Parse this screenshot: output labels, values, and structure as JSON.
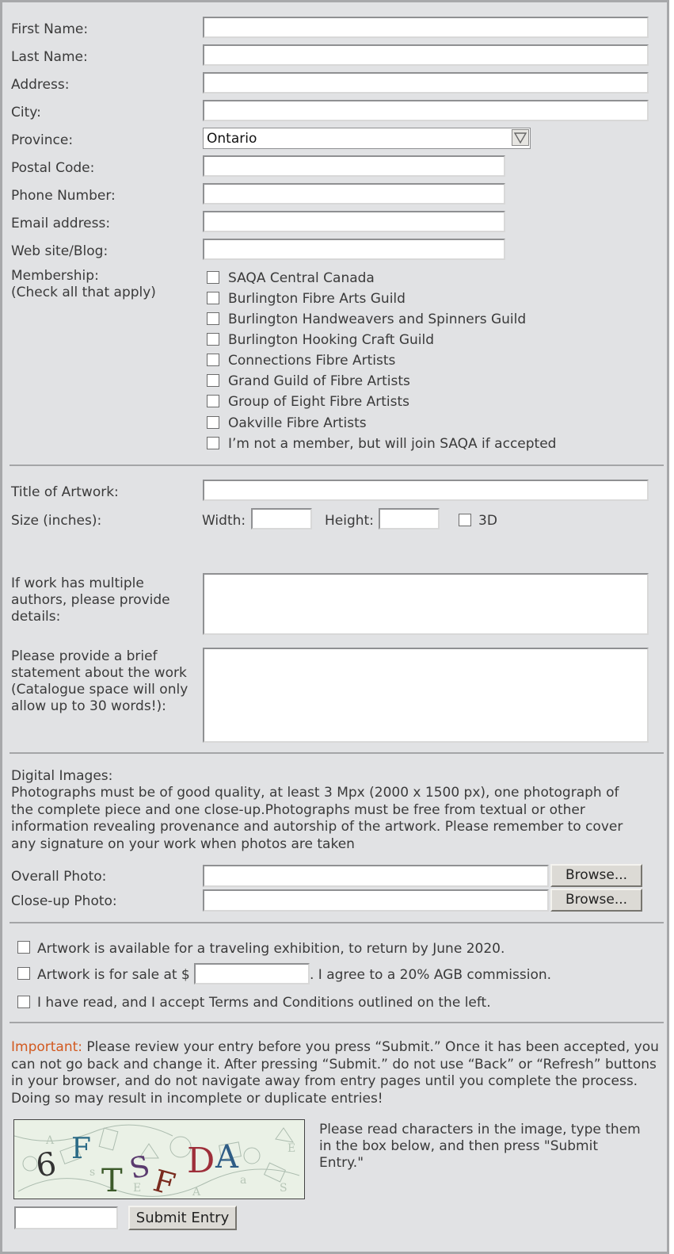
{
  "contact": {
    "first_name_label": "First Name:",
    "last_name_label": "Last Name:",
    "address_label": "Address:",
    "city_label": "City:",
    "province_label": "Province:",
    "province_value": "Ontario",
    "postal_code_label": "Postal Code:",
    "phone_label": "Phone Number:",
    "email_label": "Email address:",
    "website_label": "Web site/Blog:"
  },
  "membership": {
    "label_line1": "Membership:",
    "label_line2": "(Check all that apply)",
    "options": [
      "SAQA Central Canada",
      "Burlington Fibre Arts Guild",
      "Burlington Handweavers and Spinners Guild",
      "Burlington Hooking Craft Guild",
      "Connections Fibre Artists",
      "Grand Guild of Fibre Artists",
      "Group of Eight Fibre Artists",
      "Oakville Fibre Artists",
      "I’m not a member, but will join SAQA if accepted"
    ]
  },
  "artwork": {
    "title_label": "Title of Artwork:",
    "size_label": "Size (inches):",
    "width_label": "Width:",
    "height_label": "Height:",
    "three_d_label": "3D",
    "authors_label": [
      "If work has multiple",
      "authors, please provide",
      "details:"
    ],
    "statement_label": [
      "Please provide a brief",
      "statement about the work",
      "(Catalogue space will only",
      "allow up to 30 words!):"
    ]
  },
  "images": {
    "heading": "Digital Images:",
    "description": "Photographs must be of good quality, at least 3 Mpx (2000 x 1500 px), one photograph of the complete piece and one close-up.Photographs must be free from textual or other information revealing provenance and autorship of the artwork. Please remember to cover any signature on your work when photos are taken",
    "overall_label": "Overall Photo:",
    "closeup_label": "Close-up Photo:",
    "browse_label": "Browse..."
  },
  "terms": {
    "traveling": "Artwork is available for a traveling exhibition, to return by June 2020.",
    "sale_prefix": "Artwork is for sale at $",
    "sale_suffix": ". I agree to a 20% AGB commission.",
    "accept": "I have read, and I accept Terms and Conditions outlined on the left."
  },
  "notice": {
    "important_label": "Important:",
    "important_text": " Please review your entry before you press “Submit.” Once it has been accepted, you can not go back and change it. After pressing “Submit.” do not use “Back” or “Refresh” buttons in your browser, and do not navigate away from entry pages until you complete the process. Doing so may result in incomplete or duplicate entries!",
    "important_color": "#d2591f"
  },
  "captcha": {
    "characters": "6FTSFDA",
    "instructions": "Please read characters in the image, type them in the box below, and then press \"Submit Entry.\"",
    "submit_label": "Submit Entry"
  }
}
